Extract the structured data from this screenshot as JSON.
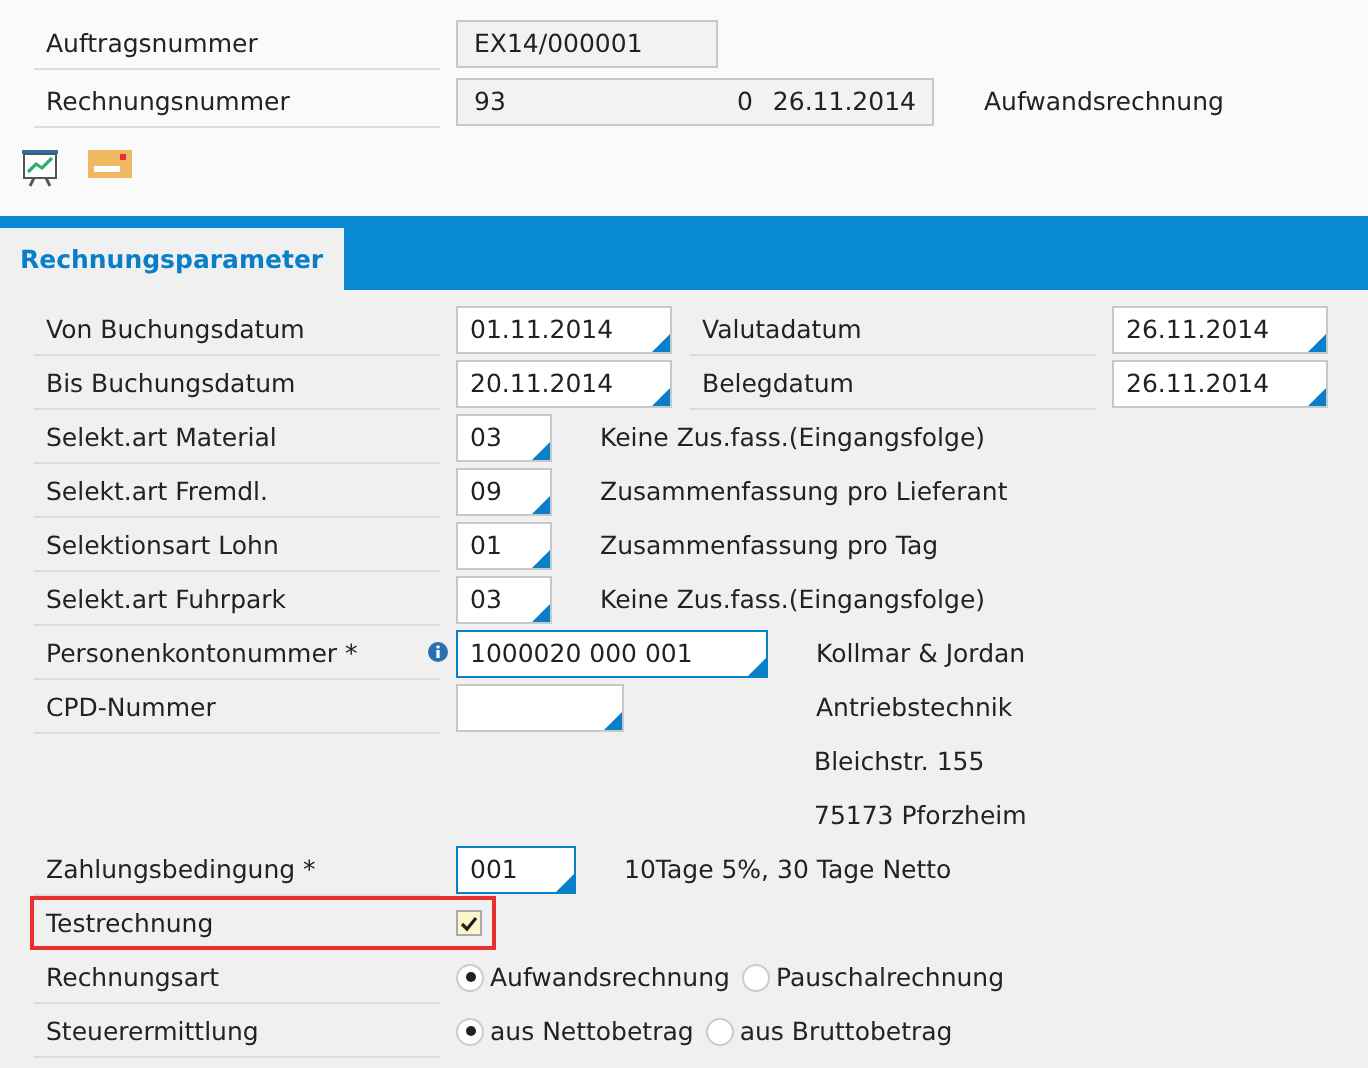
{
  "header": {
    "order": {
      "label": "Auftragsnummer",
      "value": "EX14/000001"
    },
    "invoice": {
      "label": "Rechnungsnummer",
      "number": "93",
      "counter": "0",
      "date": "26.11.2014",
      "type": "Aufwandsrechnung"
    }
  },
  "tabs": [
    {
      "label": "Rechnungsparameter",
      "selected": true
    }
  ],
  "rows": [
    {
      "kind": "date_pair",
      "label": "Von Buchungsdatum",
      "value": "01.11.2014",
      "right_label": "Valutadatum",
      "right_value": "26.11.2014"
    },
    {
      "kind": "date_pair",
      "label": "Bis Buchungsdatum",
      "value": "20.11.2014",
      "right_label": "Belegdatum",
      "right_value": "26.11.2014"
    },
    {
      "kind": "code",
      "label": "Selekt.art Material",
      "value": "03",
      "description": "Keine Zus.fass.(Eingangsfolge)",
      "required": false
    },
    {
      "kind": "code",
      "label": "Selekt.art Fremdl.",
      "value": "09",
      "description": "Zusammenfassung pro Lieferant",
      "required": false
    },
    {
      "kind": "code",
      "label": "Selektionsart Lohn",
      "value": "01",
      "description": "Zusammenfassung pro Tag",
      "required": false
    },
    {
      "kind": "code",
      "label": "Selekt.art Fuhrpark",
      "value": "03",
      "description": "Keine Zus.fass.(Eingangsfolge)",
      "required": false
    },
    {
      "kind": "account",
      "label": "Personenkontonummer *",
      "value": "1000020 000 001",
      "info": true,
      "required": true,
      "side": "Kollmar & Jordan"
    },
    {
      "kind": "account",
      "label": "CPD-Nummer",
      "required": false,
      "side": "Antriebstechnik"
    },
    {
      "kind": "side",
      "side": "Bleichstr. 155"
    },
    {
      "kind": "side",
      "side": "75173 Pforzheim"
    },
    {
      "kind": "code",
      "label": "Zahlungsbedingung *",
      "value": "001",
      "description": "10Tage 5%, 30 Tage Netto",
      "required": true
    },
    {
      "kind": "checkbox",
      "label": "Testrechnung",
      "checked": true,
      "marked": true
    },
    {
      "kind": "radio",
      "label": "Rechnungsart",
      "options": [
        {
          "label": "Aufwandsrechnung",
          "selected": true
        },
        {
          "label": "Pauschalrechnung",
          "selected": false
        }
      ]
    },
    {
      "kind": "radio",
      "label": "Steuerermittlung",
      "options": [
        {
          "label": "aus Nettobetrag",
          "selected": true
        },
        {
          "label": "aus Bruttobetrag",
          "selected": false
        }
      ]
    }
  ]
}
